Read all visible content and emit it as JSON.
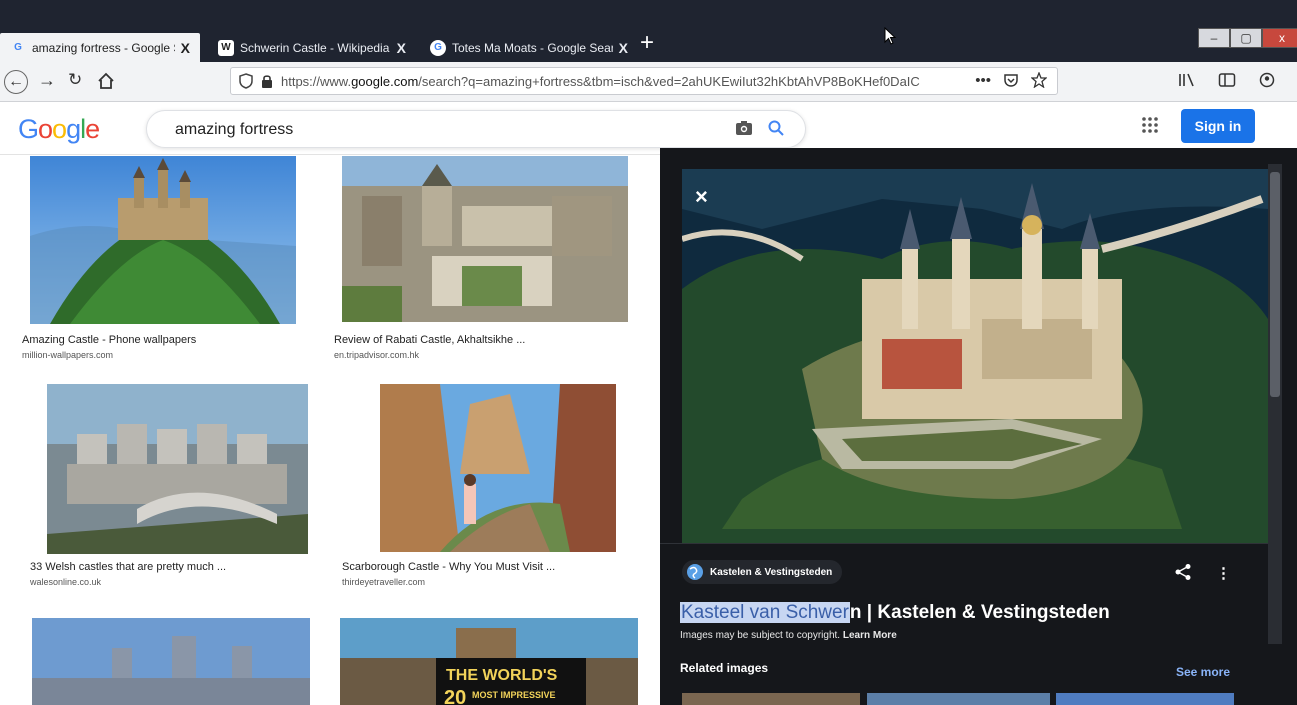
{
  "browser": {
    "tabs": [
      {
        "label": "amazing fortress - Google Searc",
        "favicon": "G",
        "close": "X",
        "active": true
      },
      {
        "label": "Schwerin Castle - Wikipedia",
        "favicon": "W",
        "close": "X",
        "active": false
      },
      {
        "label": "Totes Ma Moats - Google Searc",
        "favicon": "G",
        "close": "X",
        "active": false
      }
    ],
    "new_tab": "+",
    "url_prefix": "https://www.",
    "url_domain": "google.com",
    "url_path": "/search?q=amazing+fortress&tbm=isch&ved=2ahUKEwiIut32hKbtAhVP8BoKHef0DaIC",
    "page_actions": "•••",
    "window_buttons": [
      "–",
      "▢",
      "x"
    ]
  },
  "google": {
    "logo_letters": [
      "G",
      "o",
      "o",
      "g",
      "l",
      "e"
    ],
    "logo_colors": [
      "#4285f4",
      "#ea4335",
      "#fbbc05",
      "#4285f4",
      "#34a853",
      "#ea4335"
    ],
    "query": "amazing fortress",
    "sign_in": "Sign in"
  },
  "results": [
    {
      "title": "Amazing Castle - Phone wallpapers",
      "source": "million-wallpapers.com"
    },
    {
      "title": "Review of Rabati Castle, Akhaltsikhe ...",
      "source": "en.tripadvisor.com.hk"
    },
    {
      "title": "33 Welsh castles that are pretty much ...",
      "source": "walesonline.co.uk"
    },
    {
      "title": "Scarborough Castle - Why You Must Visit ...",
      "source": "thirdeyetraveller.com"
    },
    {
      "title": "",
      "source": ""
    },
    {
      "title": "",
      "source": "",
      "overlay_line1": "THE WORLD'S",
      "overlay_line2": "20",
      "overlay_line3": "MOST IMPRESSIVE"
    }
  ],
  "preview": {
    "close": "×",
    "source_name": "Kastelen & Vestingsteden",
    "more": "⋮",
    "title_highlighted": "Kasteel van Schwer",
    "title_rest": "n | Kastelen & Vestingsteden",
    "copyright": "Images may be subject to copyright.",
    "learn_more": "Learn More",
    "related": "Related images",
    "see_more": "See more"
  }
}
